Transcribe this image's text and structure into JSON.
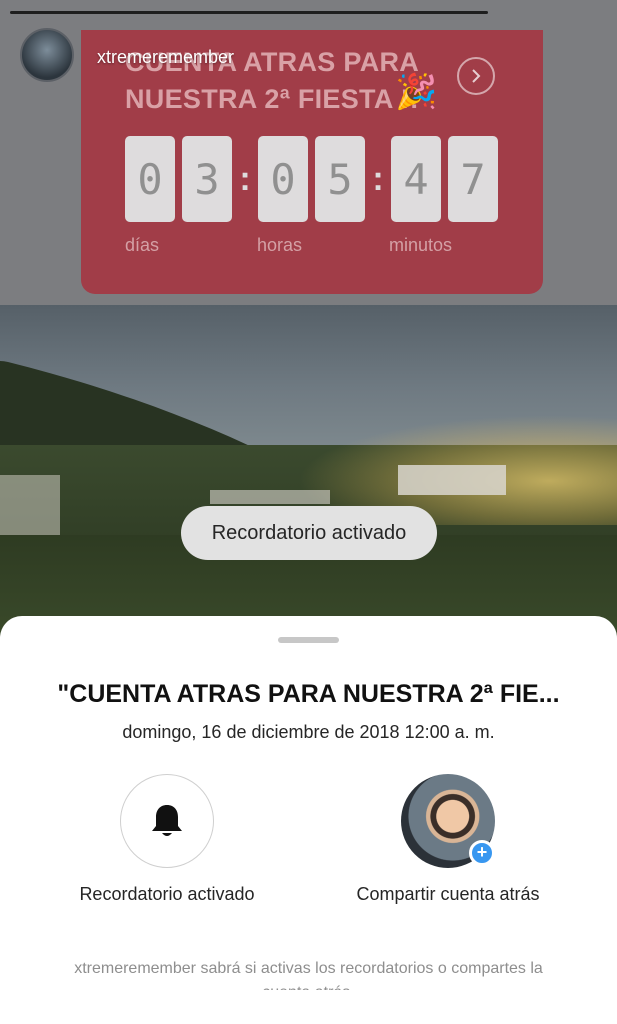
{
  "story": {
    "username": "xtremeremember",
    "sticker": {
      "title": "CUENTA ATRAS PARA NUESTRA 2ª FIESTA !!",
      "digits": [
        "0",
        "3",
        "0",
        "5",
        "4",
        "7"
      ],
      "labels": {
        "days": "días",
        "hours": "horas",
        "minutes": "minutos"
      }
    },
    "toast": "Recordatorio activado"
  },
  "sheet": {
    "title": "\"CUENTA ATRAS PARA NUESTRA 2ª FIE...",
    "date": "domingo, 16 de diciembre de 2018 12:00 a. m.",
    "actions": {
      "reminder_label": "Recordatorio activado",
      "share_label": "Compartir cuenta atrás"
    },
    "footer": "xtremeremember sabrá si activas los recordatorios o compartes la",
    "footer_cut": "cuenta atrás."
  },
  "icons": {
    "reminder": "bell-icon",
    "share_badge": "plus-icon",
    "story_next": "chevron-right-icon"
  },
  "colors": {
    "sticker_bg": "#a13d48",
    "badge_blue": "#3897f0"
  }
}
